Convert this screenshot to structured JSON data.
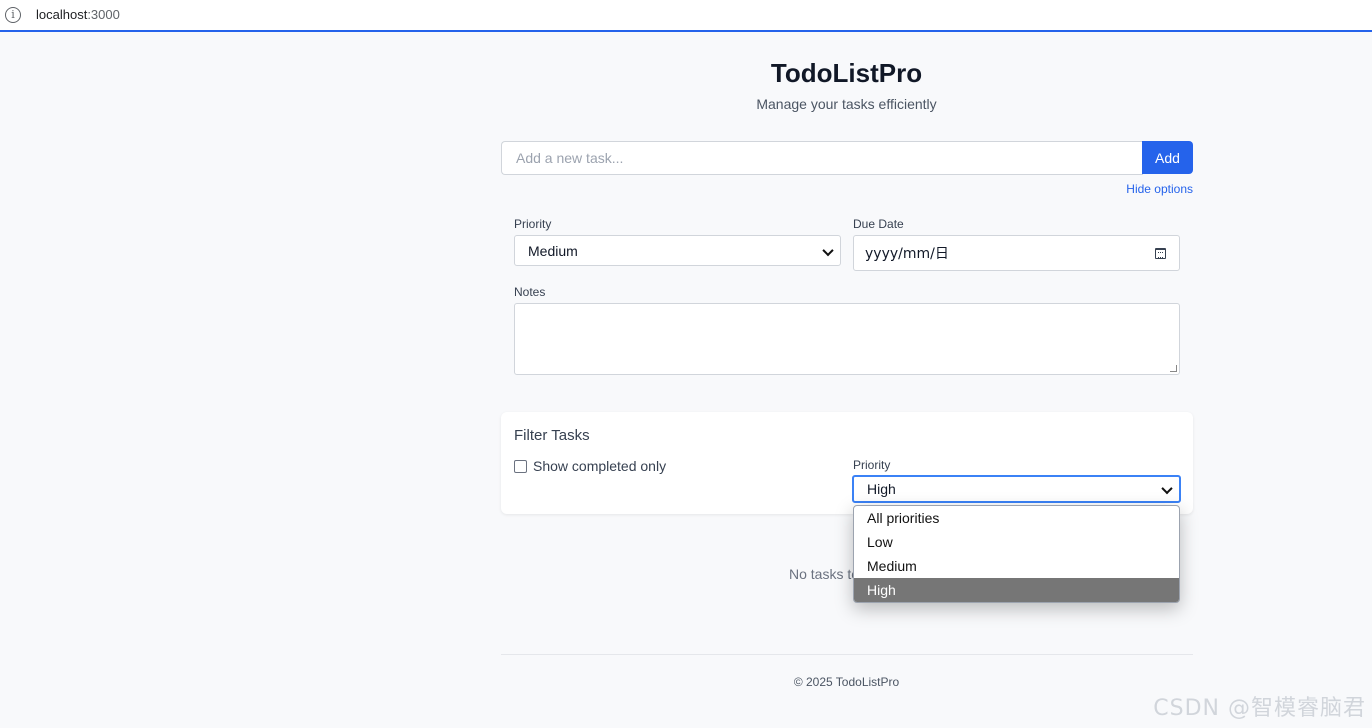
{
  "browser": {
    "url_host": "localhost",
    "url_port": ":3000"
  },
  "header": {
    "title": "TodoListPro",
    "subtitle": "Manage your tasks efficiently"
  },
  "add_task": {
    "placeholder": "Add a new task...",
    "add_label": "Add",
    "toggle_options_label": "Hide options"
  },
  "options": {
    "priority_label": "Priority",
    "priority_value": "Medium",
    "due_date_label": "Due Date",
    "due_date_value": "yyyy/mm/日",
    "notes_label": "Notes"
  },
  "filter": {
    "title": "Filter Tasks",
    "show_completed_label": "Show completed only",
    "show_completed_checked": false,
    "priority_label": "Priority",
    "priority_value": "High",
    "priority_options": [
      "All priorities",
      "Low",
      "Medium",
      "High"
    ],
    "highlighted_option": "High"
  },
  "empty_state": "No tasks to",
  "footer": "© 2025 TodoListPro",
  "watermark": "CSDN @智模睿脑君",
  "colors": {
    "accent": "#2563eb",
    "focus_ring": "#3b82f6",
    "highlight": "#767676"
  }
}
